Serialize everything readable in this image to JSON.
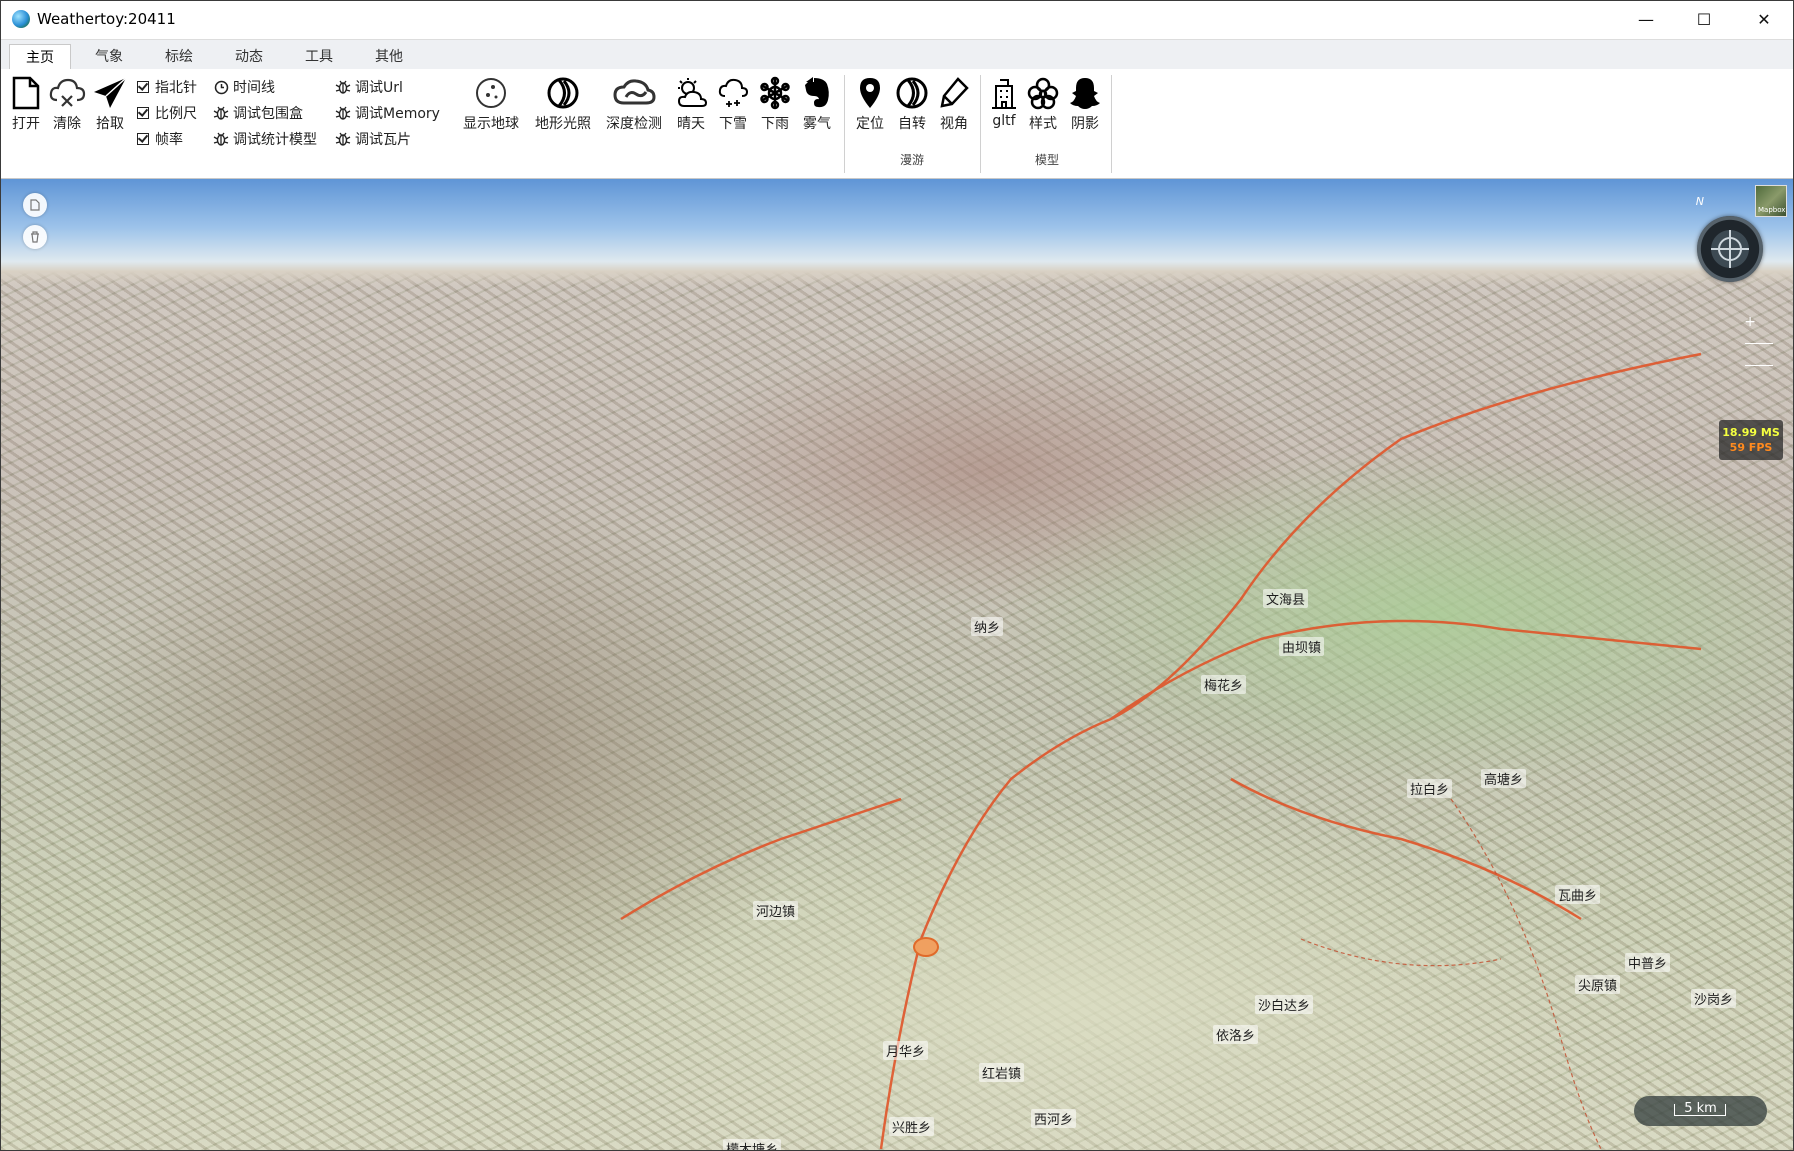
{
  "window": {
    "title": "Weathertoy:20411",
    "minimize": "—",
    "maximize": "☐",
    "close": "✕"
  },
  "tabs": [
    {
      "label": "主页",
      "active": true
    },
    {
      "label": "气象"
    },
    {
      "label": "标绘"
    },
    {
      "label": "动态"
    },
    {
      "label": "工具"
    },
    {
      "label": "其他"
    }
  ],
  "ribbon": {
    "open": "打开",
    "clear": "清除",
    "pick": "拾取",
    "checks": {
      "compass": "指北针",
      "scale": "比例尺",
      "fps": "帧率"
    },
    "debug": {
      "timeline": "时间线",
      "bbox": "调试包围盒",
      "stats": "调试统计模型",
      "url": "调试Url",
      "memory": "调试Memory",
      "tiles": "调试瓦片"
    },
    "show_globe": "显示地球",
    "terrain_light": "地形光照",
    "depth_test": "深度检测",
    "sunny": "晴天",
    "snow": "下雪",
    "rain": "下雨",
    "fog": "雾气",
    "locate": "定位",
    "rotate": "自转",
    "view": "视角",
    "roam_group": "漫游",
    "gltf": "gltf",
    "style": "样式",
    "shadow": "阴影",
    "model_group": "模型"
  },
  "map": {
    "compass_n": "N",
    "base_layer": "Mapbox",
    "zoom_in": "+",
    "fps_ms": "18.99 MS",
    "fps_value": "59 FPS",
    "scale_label": "5 km",
    "places": [
      "文海县",
      "由坝镇",
      "梅花乡",
      "河边镇",
      "月华乡",
      "兴胜乡",
      "红岩镇",
      "西河乡",
      "依洛乡",
      "沙白达乡",
      "中普乡",
      "沙岗乡",
      "拉白乡",
      "瓦曲乡",
      "尖原镇",
      "檬木塘乡",
      "纳乡",
      "高塘乡"
    ],
    "accent": "#e0552a"
  }
}
